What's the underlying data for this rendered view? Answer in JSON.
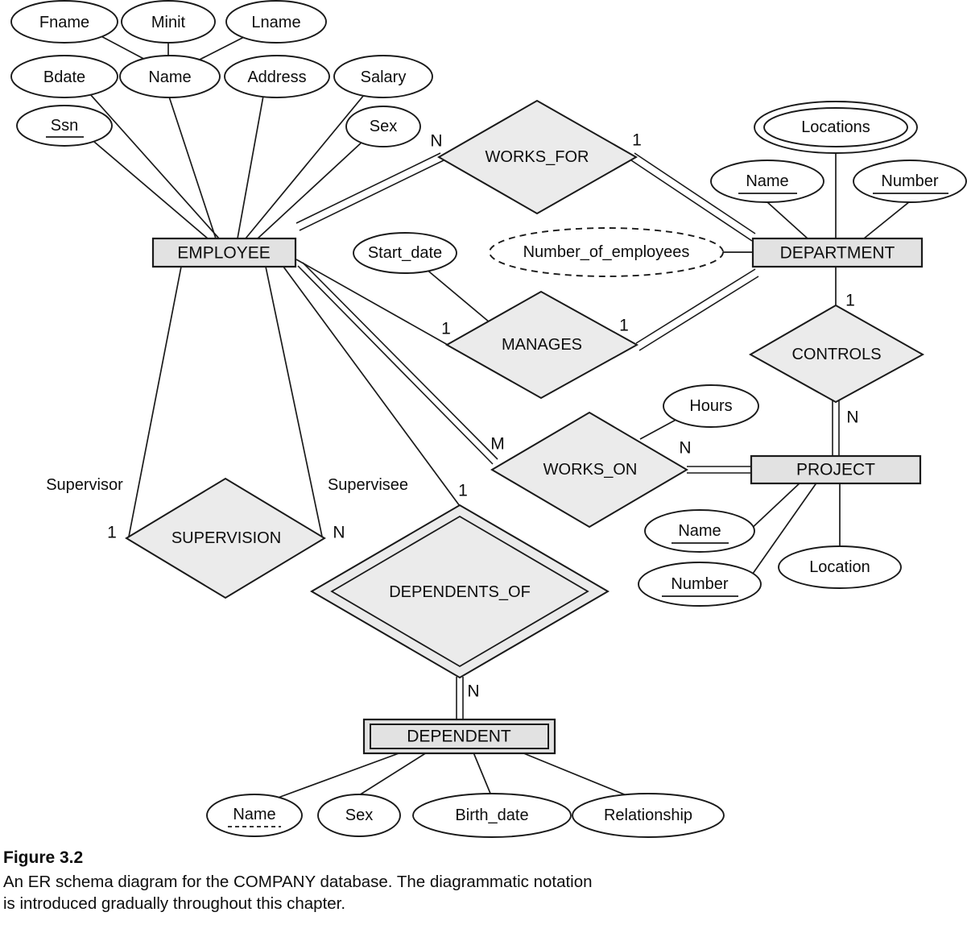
{
  "figure": {
    "label": "Figure 3.2",
    "description_line1": "An ER schema diagram for the COMPANY database. The diagrammatic notation",
    "description_line2": "is introduced gradually throughout this chapter."
  },
  "colors": {
    "entity_fill": "#e2e2e2",
    "relationship_fill": "#ebebeb",
    "attribute_fill": "#ffffff",
    "stroke": "#1a1a1a",
    "background": "#ffffff"
  },
  "diagram": {
    "type": "er-schema",
    "title": "COMPANY database ER schema",
    "entities": [
      {
        "id": "employee",
        "name": "EMPLOYEE",
        "weak": false
      },
      {
        "id": "department",
        "name": "DEPARTMENT",
        "weak": false
      },
      {
        "id": "project",
        "name": "PROJECT",
        "weak": false
      },
      {
        "id": "dependent",
        "name": "DEPENDENT",
        "weak": true
      }
    ],
    "relationships": [
      {
        "id": "works_for",
        "name": "WORKS_FOR",
        "identifying": false
      },
      {
        "id": "manages",
        "name": "MANAGES",
        "identifying": false
      },
      {
        "id": "controls",
        "name": "CONTROLS",
        "identifying": false
      },
      {
        "id": "works_on",
        "name": "WORKS_ON",
        "identifying": false
      },
      {
        "id": "supervision",
        "name": "SUPERVISION",
        "identifying": false
      },
      {
        "id": "dependents_of",
        "name": "DEPENDENTS_OF",
        "identifying": true
      }
    ],
    "attributes": {
      "employee": [
        {
          "name": "Fname",
          "kind": "simple"
        },
        {
          "name": "Minit",
          "kind": "simple"
        },
        {
          "name": "Lname",
          "kind": "simple"
        },
        {
          "name": "Name",
          "kind": "composite"
        },
        {
          "name": "Bdate",
          "kind": "simple"
        },
        {
          "name": "Address",
          "kind": "simple"
        },
        {
          "name": "Salary",
          "kind": "simple"
        },
        {
          "name": "Ssn",
          "kind": "key"
        },
        {
          "name": "Sex",
          "kind": "simple"
        }
      ],
      "department": [
        {
          "name": "Locations",
          "kind": "multivalued"
        },
        {
          "name": "Name",
          "kind": "key"
        },
        {
          "name": "Number",
          "kind": "key"
        },
        {
          "name": "Number_of_employees",
          "kind": "derived"
        }
      ],
      "project": [
        {
          "name": "Name",
          "kind": "key"
        },
        {
          "name": "Number",
          "kind": "key"
        },
        {
          "name": "Location",
          "kind": "simple"
        }
      ],
      "dependent": [
        {
          "name": "Name",
          "kind": "partial-key"
        },
        {
          "name": "Sex",
          "kind": "simple"
        },
        {
          "name": "Birth_date",
          "kind": "simple"
        },
        {
          "name": "Relationship",
          "kind": "simple"
        }
      ],
      "manages": [
        {
          "name": "Start_date",
          "kind": "simple"
        }
      ],
      "works_on": [
        {
          "name": "Hours",
          "kind": "simple"
        }
      ]
    },
    "cardinalities": {
      "works_for_employee": "N",
      "works_for_department": "1",
      "manages_employee": "1",
      "manages_department": "1",
      "controls_department": "1",
      "controls_project": "N",
      "works_on_employee": "M",
      "works_on_project": "N",
      "supervision_supervisor": "1",
      "supervision_supervisee": "N",
      "dependents_of_employee": "1",
      "dependents_of_dependent": "N"
    },
    "roles": {
      "supervisor": "Supervisor",
      "supervisee": "Supervisee"
    }
  }
}
